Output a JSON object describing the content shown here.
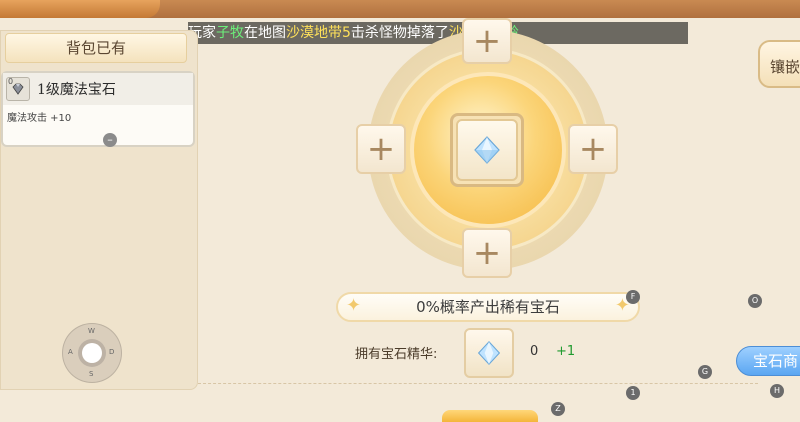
{
  "marquee": {
    "parts": [
      {
        "text": "玩家",
        "color": "#ffffff"
      },
      {
        "text": "子牧",
        "color": "#6cf07a"
      },
      {
        "text": "在地图",
        "color": "#ffffff"
      },
      {
        "text": "沙漠地带5",
        "color": "#ffe15a"
      },
      {
        "text": "击杀怪物掉落了",
        "color": "#ffffff"
      },
      {
        "text": "沙盗暴风",
        "color": "#ffe15a"
      },
      {
        "text": "铃",
        "color": "#6cf07a"
      }
    ]
  },
  "inventory": {
    "title": "背包已有",
    "items": [
      {
        "level_badge": "0",
        "name": "1级魔法宝石",
        "stat": "魔法攻击 +10",
        "remove_icon": "minus-icon"
      }
    ]
  },
  "joystick": {
    "up": "W",
    "down": "S",
    "left": "A",
    "right": "D"
  },
  "socket": {
    "center_icon": "gem-icon",
    "empty_slot_icon": "plus-icon",
    "chance_text": "0%概率产出稀有宝石"
  },
  "essence": {
    "label": "拥有宝石精华:",
    "icon": "gem-icon",
    "count": "0",
    "add": "+1"
  },
  "side_tab": {
    "label": "镶嵌"
  },
  "shop_button": {
    "label": "宝石商"
  },
  "hotkeys": {
    "f": "F",
    "o": "O",
    "g": "G",
    "h": "H",
    "one": "1",
    "z": "Z"
  },
  "colors": {
    "accent_orange": "#f5b63c",
    "shop_blue": "#5aa6f2",
    "add_green": "#1f9a2e"
  }
}
